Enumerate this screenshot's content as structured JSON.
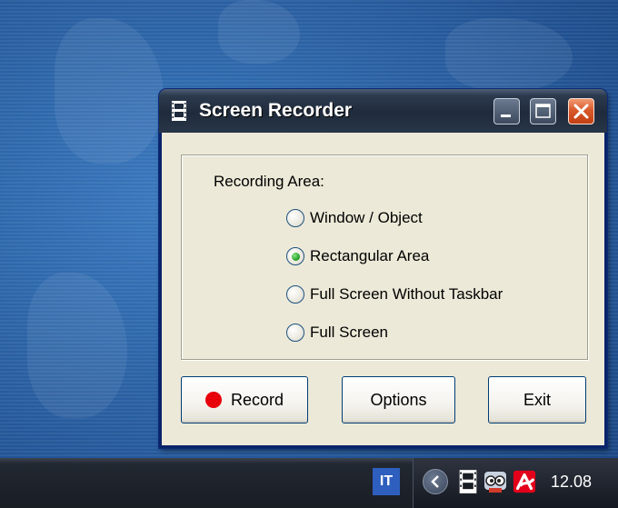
{
  "window": {
    "title": "Screen Recorder",
    "controls": {
      "minimize": "minimize",
      "maximize": "maximize",
      "close": "close"
    }
  },
  "recording_area": {
    "label": "Recording Area:",
    "options": [
      {
        "label": "Window / Object",
        "selected": false
      },
      {
        "label": "Rectangular Area",
        "selected": true
      },
      {
        "label": "Full Screen Without Taskbar",
        "selected": false
      },
      {
        "label": "Full Screen",
        "selected": false
      }
    ]
  },
  "buttons": {
    "record": "Record",
    "options": "Options",
    "exit": "Exit"
  },
  "taskbar": {
    "language": "IT",
    "clock": "12.08"
  },
  "colors": {
    "record_dot": "#e8000b",
    "close_button": "#d85a2a",
    "radio_selected": "#28a528"
  }
}
